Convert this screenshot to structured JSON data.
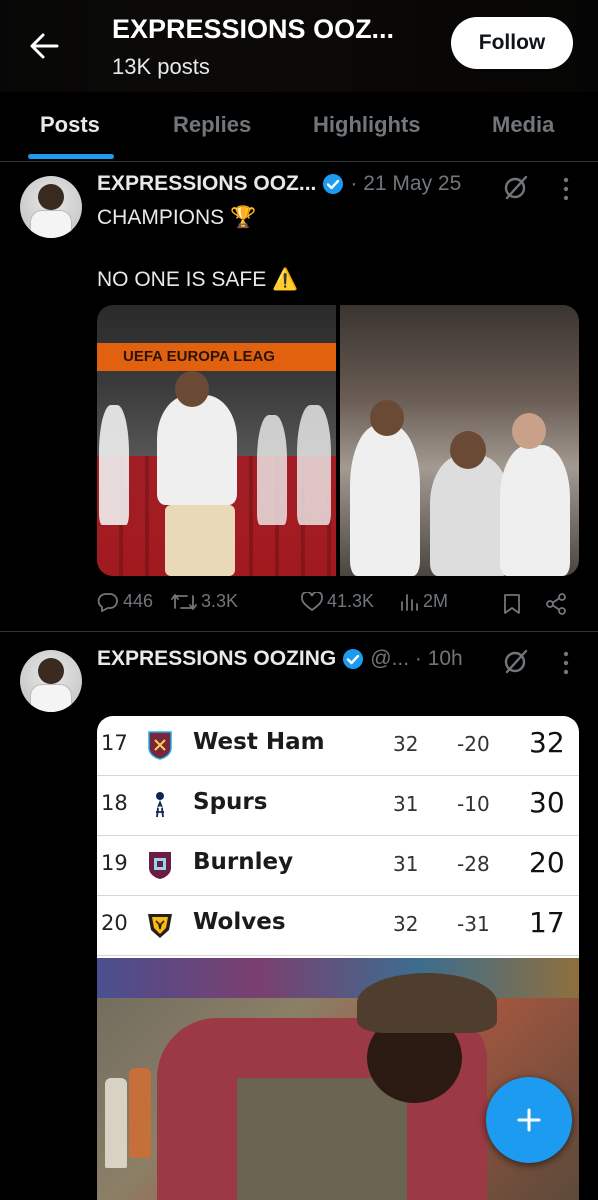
{
  "header": {
    "title": "EXPRESSIONS OOZ...",
    "post_count": "13K posts",
    "follow_label": "Follow"
  },
  "tabs": [
    {
      "label": "Posts",
      "active": true
    },
    {
      "label": "Replies",
      "active": false
    },
    {
      "label": "Highlights",
      "active": false
    },
    {
      "label": "Media",
      "active": false
    }
  ],
  "posts": [
    {
      "author": "EXPRESSIONS OOZ...",
      "meta": "· 21 May 25",
      "text_line1": "CHAMPIONS 🏆",
      "text_line2": "NO ONE IS SAFE ⚠️",
      "image_banner": "UEFA EUROPA LEAG",
      "stats": {
        "replies": "446",
        "reposts": "3.3K",
        "likes": "41.3K",
        "views": "2M"
      }
    },
    {
      "author": "EXPRESSIONS OOZING",
      "meta": "@... · 10h",
      "table": [
        {
          "pos": "17",
          "team": "West Ham",
          "played": "32",
          "gd": "-20",
          "pts": "32"
        },
        {
          "pos": "18",
          "team": "Spurs",
          "played": "31",
          "gd": "-10",
          "pts": "30"
        },
        {
          "pos": "19",
          "team": "Burnley",
          "played": "31",
          "gd": "-28",
          "pts": "20"
        },
        {
          "pos": "20",
          "team": "Wolves",
          "played": "32",
          "gd": "-31",
          "pts": "17"
        }
      ]
    }
  ],
  "colors": {
    "accent": "#1d9bf0",
    "background": "#000000",
    "muted": "#71767b",
    "text": "#e7e9ea"
  }
}
